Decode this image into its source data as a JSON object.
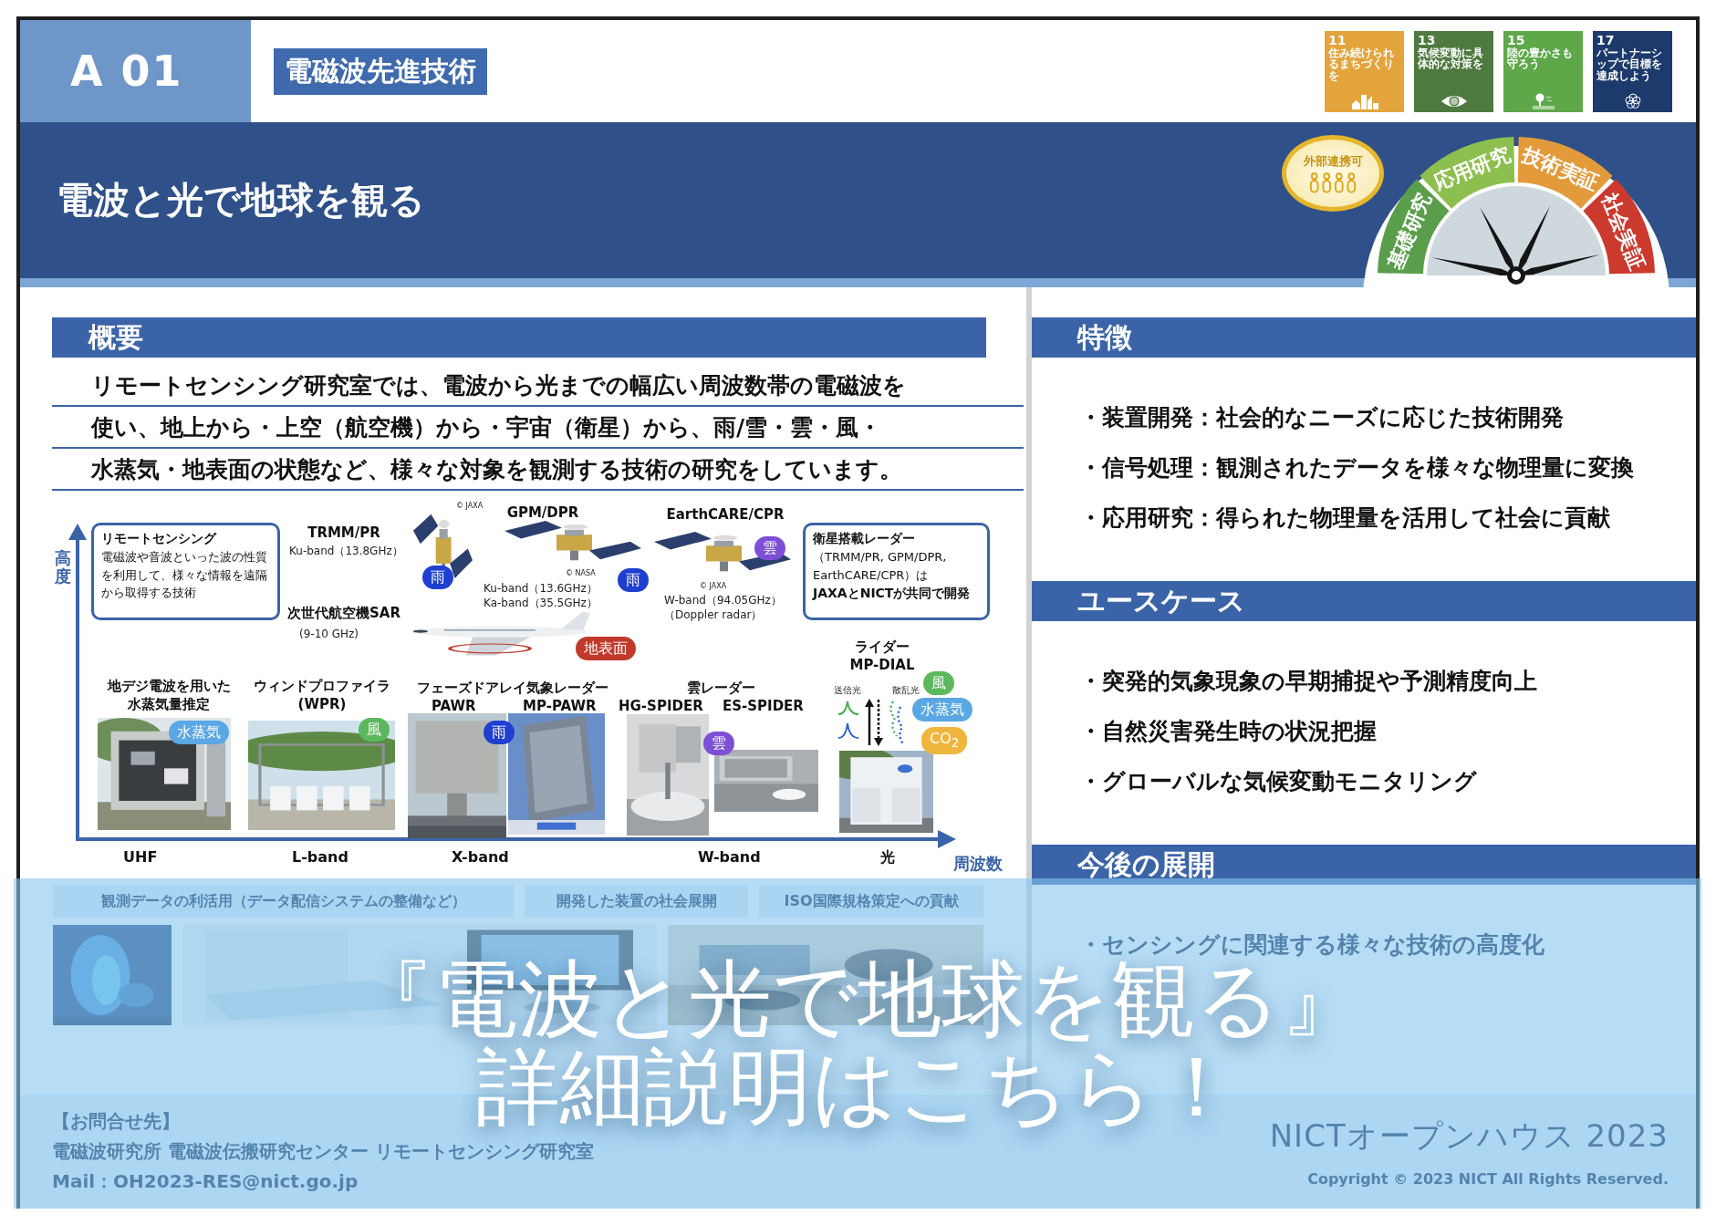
{
  "header": {
    "code": "A 01",
    "category": "電磁波先進技術",
    "sdgs": [
      {
        "number": "11",
        "caption": "住み続けられるまちづくりを",
        "color": "#e3a43b"
      },
      {
        "number": "13",
        "caption": "気候変動に具体的な対策を",
        "color": "#4f7a3f"
      },
      {
        "number": "15",
        "caption": "陸の豊かさも守ろう",
        "color": "#5fa84a"
      },
      {
        "number": "17",
        "caption": "パートナーシップで目標を達成しよう",
        "color": "#1c3a6b"
      }
    ]
  },
  "title": "電波と光で地球を観る",
  "maturity": {
    "badge": "外部連携可",
    "stages": [
      {
        "label": "基礎研究",
        "color": "#5a9e4b"
      },
      {
        "label": "応用研究",
        "color": "#8dbf4f"
      },
      {
        "label": "技術実証",
        "color": "#e39a3b"
      },
      {
        "label": "社会実証",
        "color": "#cc3a2e"
      }
    ]
  },
  "overview": {
    "heading": "概要",
    "lines": [
      "リモートセンシング研究室では、電波から光までの幅広い周波数帯の電磁波を",
      "使い、地上から・上空（航空機）から・宇宙（衛星）から、雨/雪・雲・風・",
      "水蒸気・地表面の状態など、様々な対象を観測する技術の研究をしています。"
    ]
  },
  "diagram": {
    "y_axis": "高度",
    "x_axis": "周波数",
    "bands": [
      "UHF",
      "L-band",
      "X-band",
      "W-band",
      "光"
    ],
    "definition": {
      "title": "リモートセンシング",
      "text": "電磁波や音波といった波の性質を利用して、様々な情報を遠隔から取得する技術"
    },
    "note": {
      "title": "衛星搭載レーダー",
      "text": "（TRMM/PR, GPM/DPR, EarthCARE/CPR）は",
      "emphasis": "JAXAとNICTが共同で開発"
    },
    "platforms": [
      {
        "name": [
          "TRMM/PR"
        ],
        "specs": [
          "Ku-band（13.8GHz）"
        ],
        "credit": "© JAXA",
        "targets": [
          {
            "label": "雨",
            "color": "#1f3fd0"
          }
        ]
      },
      {
        "name": [
          "GPM/DPR"
        ],
        "specs": [
          "Ku-band（13.6GHz）",
          "Ka-band（35.5GHz）"
        ],
        "credit": "© NASA",
        "targets": [
          {
            "label": "雨",
            "color": "#1f3fd0"
          }
        ]
      },
      {
        "name": [
          "EarthCARE/CPR"
        ],
        "specs": [
          "W-band（94.05GHz）",
          "（Doppler radar）"
        ],
        "credit": "© JAXA",
        "targets": [
          {
            "label": "雲",
            "color": "#7d4fd6"
          }
        ]
      },
      {
        "name": [
          "次世代航空機SAR"
        ],
        "specs": [
          "(9-10 GHz)"
        ],
        "targets": [
          {
            "label": "地表面",
            "color": "#c0392b"
          }
        ]
      },
      {
        "name": [
          "地デジ電波を用いた",
          "水蒸気量推定"
        ],
        "targets": [
          {
            "label": "水蒸気",
            "color": "#5aa7e3"
          }
        ]
      },
      {
        "name": [
          "ウィンドプロファイラ",
          "(WPR)"
        ],
        "targets": [
          {
            "label": "風",
            "color": "#5cb85c"
          }
        ]
      },
      {
        "name": [
          "フェーズドアレイ気象レーダー"
        ],
        "units": [
          "PAWR",
          "MP-PAWR"
        ],
        "targets": [
          {
            "label": "雨",
            "color": "#1f3fd0"
          }
        ]
      },
      {
        "name": [
          "雲レーダー"
        ],
        "units": [
          "HG-SPIDER",
          "ES-SPIDER"
        ],
        "targets": [
          {
            "label": "雲",
            "color": "#7d4fd6"
          }
        ]
      },
      {
        "name": [
          "ライダー",
          "MP-DIAL"
        ],
        "signals": [
          "送信光",
          "散乱光"
        ],
        "targets": [
          {
            "label": "風",
            "color": "#5cb85c"
          },
          {
            "label": "水蒸気",
            "color": "#5aa7e3"
          },
          {
            "label": "CO$_{2}$",
            "color": "#f0b53c"
          }
        ]
      }
    ]
  },
  "outcomes": [
    "観測データの利活用（データ配信システムの整備など）",
    "開発した装置の社会展開",
    "ISO国際規格策定への貢献"
  ],
  "features": {
    "heading": "特徴",
    "items": [
      "・装置開発：社会的なニーズに応じた技術開発",
      "・信号処理：観測されたデータを様々な物理量に変換",
      "・応用研究：得られた物理量を活用して社会に貢献"
    ]
  },
  "use_cases": {
    "heading": "ユースケース",
    "items": [
      "・突発的気象現象の早期捕捉や予測精度向上",
      "・自然災害発生時の状況把握",
      "・グローバルな気候変動モニタリング"
    ]
  },
  "future": {
    "heading": "今後の展開",
    "items": [
      "・センシングに関連する様々な技術の高度化"
    ]
  },
  "contact": {
    "heading": "【お問合せ先】",
    "organization": "電磁波研究所 電磁波伝搬研究センター リモートセンシング研究室",
    "mail": "Mail：OH2023-RES@nict.go.jp"
  },
  "footer": {
    "event": "NICTオープンハウス 2023",
    "copyright": "Copyright © 2023 NICT All Rights Reserved."
  },
  "banner": {
    "lines": [
      "『電波と光で地球を観る』",
      "詳細説明はこちら！"
    ]
  }
}
